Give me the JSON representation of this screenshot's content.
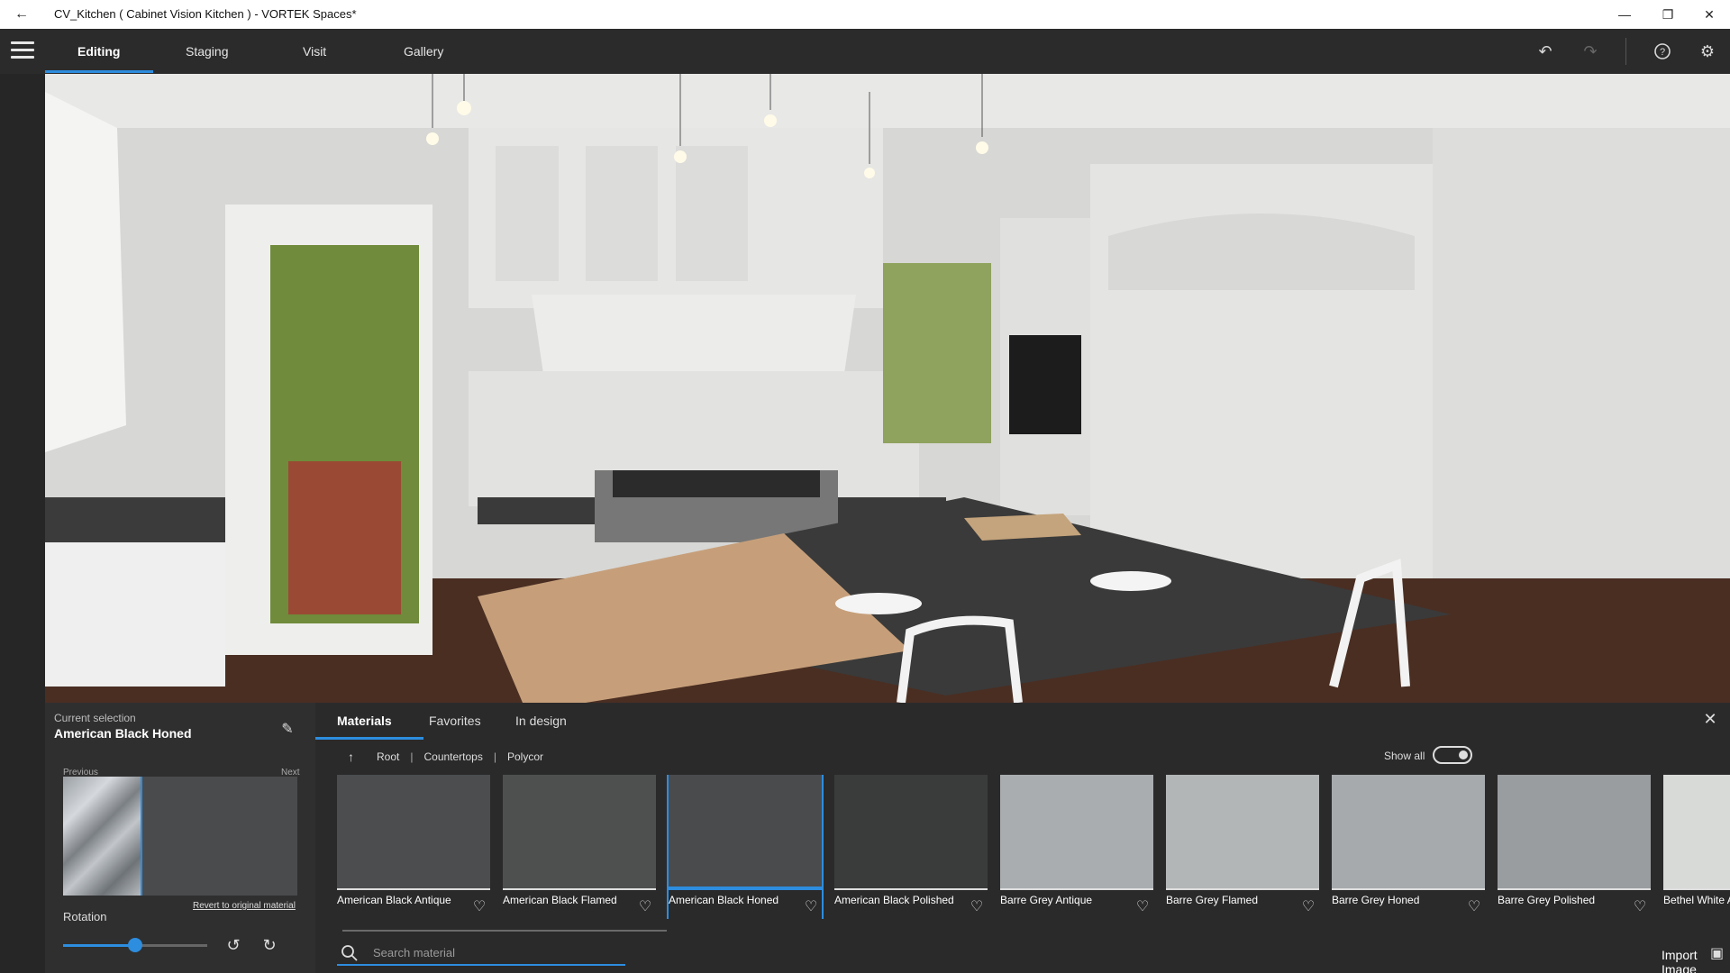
{
  "window": {
    "title": "CV_Kitchen ( Cabinet Vision Kitchen ) - VORTEK Spaces*",
    "controls": {
      "minimize": "—",
      "restore": "❐",
      "close": "✕"
    }
  },
  "nav": {
    "tabs": [
      {
        "label": "Editing"
      },
      {
        "label": "Staging"
      },
      {
        "label": "Visit"
      },
      {
        "label": "Gallery"
      }
    ],
    "active_tab": "Editing",
    "icons": [
      "undo-icon",
      "redo-icon",
      "help-icon",
      "settings-icon"
    ]
  },
  "selection": {
    "label": "Current selection",
    "name": "American Black Honed",
    "previous_label": "Previous",
    "next_label": "Next",
    "revert_label": "Revert to original material",
    "rotation_label": "Rotation",
    "rotation_value": 0.5
  },
  "materials": {
    "tabs": [
      {
        "label": "Materials"
      },
      {
        "label": "Favorites"
      },
      {
        "label": "In design"
      }
    ],
    "breadcrumb": [
      "Root",
      "Countertops",
      "Polycor"
    ],
    "show_all_label": "Show all",
    "show_all": true,
    "tiles": [
      {
        "name": "American Black Antique",
        "color": "#4b4d4f",
        "selected": false
      },
      {
        "name": "American Black Flamed",
        "color": "#4e504f",
        "selected": false
      },
      {
        "name": "American Black Honed",
        "color": "#4a4b4d",
        "selected": true
      },
      {
        "name": "American Black Polished",
        "color": "#3a3c3c",
        "selected": false
      },
      {
        "name": "Barre Grey Antique",
        "color": "#a9adaf",
        "selected": false
      },
      {
        "name": "Barre Grey Flamed",
        "color": "#b3b6b7",
        "selected": false
      },
      {
        "name": "Barre Grey Honed",
        "color": "#a6aaac",
        "selected": false
      },
      {
        "name": "Barre Grey Polished",
        "color": "#999d9f",
        "selected": false
      },
      {
        "name": "Bethel White A",
        "color": "#d8dad8",
        "selected": false
      }
    ],
    "search_placeholder": "Search material",
    "import_label": "Import Image"
  },
  "colors": {
    "accent": "#2d8ddf"
  }
}
